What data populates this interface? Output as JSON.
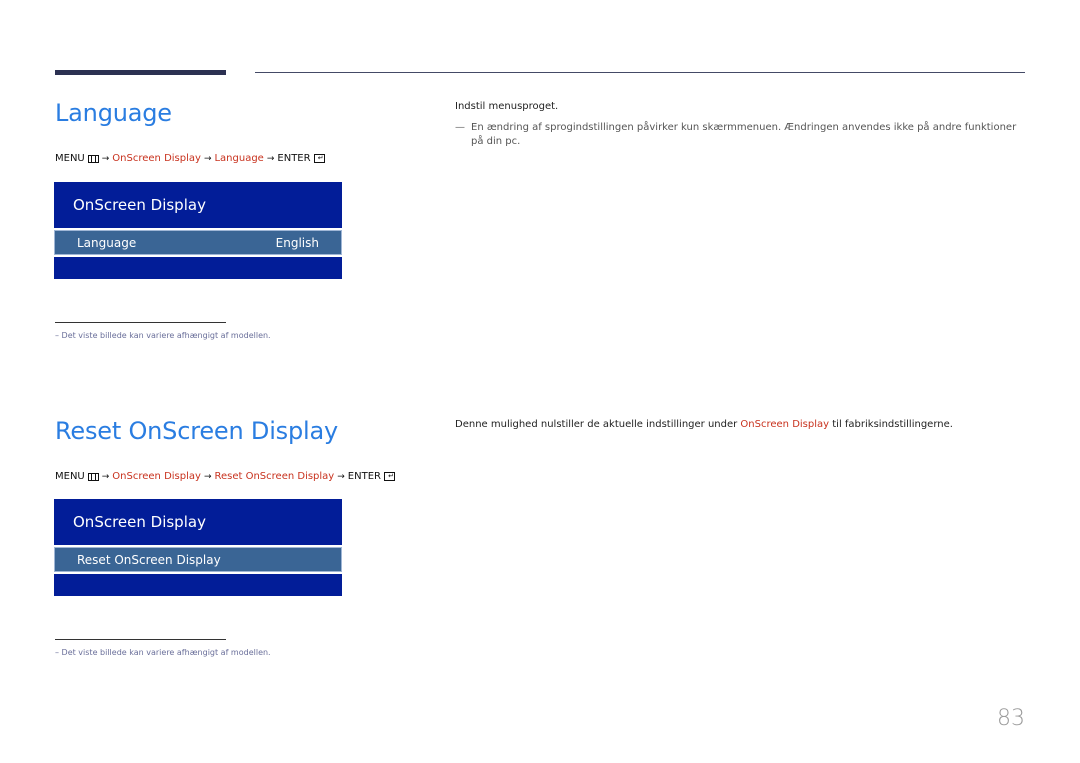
{
  "sections": [
    {
      "title": "Language",
      "path": {
        "menu": "MENU",
        "menu_icon": "menu-icon",
        "steps": [
          "OnScreen Display",
          "Language"
        ],
        "enter": "ENTER",
        "enter_icon": "enter-icon",
        "arrow": "→"
      },
      "osd": {
        "header": "OnScreen Display",
        "row_label": "Language",
        "row_value": "English"
      },
      "footnote": "–  Det viste billede kan variere afhængigt af modellen.",
      "description": "Indstil menusproget.",
      "note_dash": "—",
      "note": "En ændring af sprogindstillingen påvirker kun skærmmenuen. Ændringen anvendes ikke på andre funktioner på din pc."
    },
    {
      "title": "Reset OnScreen Display",
      "path": {
        "menu": "MENU",
        "menu_icon": "menu-icon",
        "steps": [
          "OnScreen Display",
          "Reset OnScreen Display"
        ],
        "enter": "ENTER",
        "enter_icon": "enter-icon",
        "arrow": "→"
      },
      "osd": {
        "header": "OnScreen Display",
        "row_label": "Reset OnScreen Display",
        "row_value": ""
      },
      "footnote": "–  Det viste billede kan variere afhængigt af modellen.",
      "description_before": "Denne mulighed nulstiller de aktuelle indstillinger under ",
      "description_link": "OnScreen Display",
      "description_after": " til fabriksindstillingerne."
    }
  ],
  "page_number": "83",
  "colors": {
    "heading": "#2a7de1",
    "path_highlight": "#c8321e",
    "osd_background": "#021d98",
    "osd_selected_row": "#3a6595"
  }
}
